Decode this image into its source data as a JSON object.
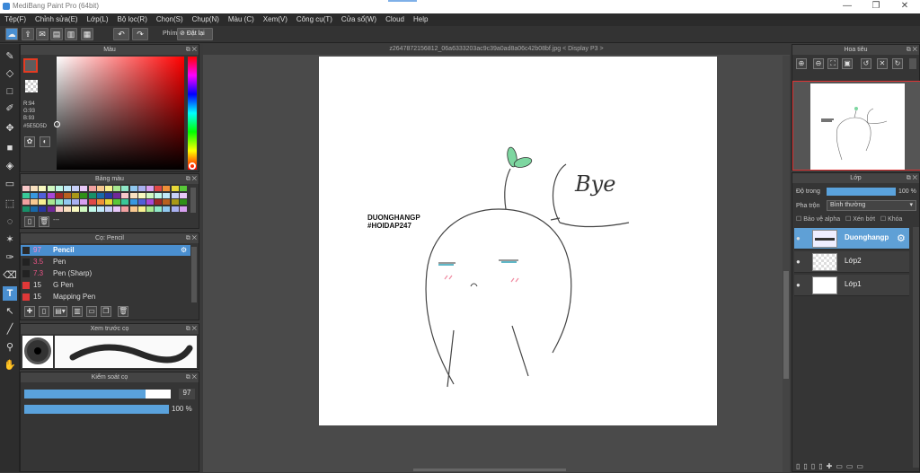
{
  "window": {
    "title": "MediBang Paint Pro (64bit)",
    "minimize": "—",
    "maximize": "❐",
    "close": "✕"
  },
  "menu": [
    "Tệp(F)",
    "Chỉnh sửa(E)",
    "Lớp(L)",
    "Bộ lọc(R)",
    "Chọn(S)",
    "Chụp(N)",
    "Màu (C)",
    "Xem(V)",
    "Công cụ(T)",
    "Cửa sổ(W)",
    "Cloud",
    "Help"
  ],
  "toolbar": {
    "filter_label": "Phím",
    "reset_label": "Đặt lại"
  },
  "color_panel": {
    "title": "Màu",
    "rgb": "R:94\nG:93\nB:93",
    "r": "R:94",
    "g": "G:93",
    "b": "B:93",
    "hex": "#5E5D5D",
    "fg_color": "#5e5d5d",
    "accent": "#e53b22"
  },
  "palette_panel": {
    "title": "Bảng màu",
    "field_value": "---"
  },
  "brush_panel": {
    "title": "Cọ: Pencil",
    "brushes": [
      {
        "size": "97",
        "name": "Pencil",
        "color": "#2a2a2a"
      },
      {
        "size": "3.5",
        "name": "Pen",
        "color": "#222"
      },
      {
        "size": "7.3",
        "name": "Pen (Sharp)",
        "color": "#222"
      },
      {
        "size": "15",
        "name": "G Pen",
        "color": "#e03838"
      },
      {
        "size": "15",
        "name": "Mapping Pen",
        "color": "#e03838"
      }
    ]
  },
  "preview_panel": {
    "title": "Xem trước cọ"
  },
  "control_panel": {
    "title": "Kiểm soát cọ",
    "size_value": "97",
    "opacity_value": "100 %",
    "size_fraction": 0.83,
    "opacity_fraction": 1.0
  },
  "document": {
    "title": "z2647872156812_06a6333203ac9c39a0ad8a06c42b08bf.jpg < Display P3 >"
  },
  "artwork": {
    "text_line1": "DUONGHANGP",
    "text_line2": "#HOIDAP247",
    "speech": "Bye"
  },
  "navigator": {
    "title": "Hoa tiêu"
  },
  "layers_panel": {
    "title": "Lớp",
    "opacity_label": "Độ trong",
    "opacity_value": "100 %",
    "blend_label": "Pha trộn",
    "blend_value": "Bình thường",
    "protect_alpha": "Bảo vệ alpha",
    "clipping": "Xén bớt",
    "lock": "Khóa",
    "layers": [
      {
        "name": "Duonghangp",
        "selected": true
      },
      {
        "name": "Lớp2",
        "selected": false
      },
      {
        "name": "Lớp1",
        "selected": false
      }
    ]
  }
}
